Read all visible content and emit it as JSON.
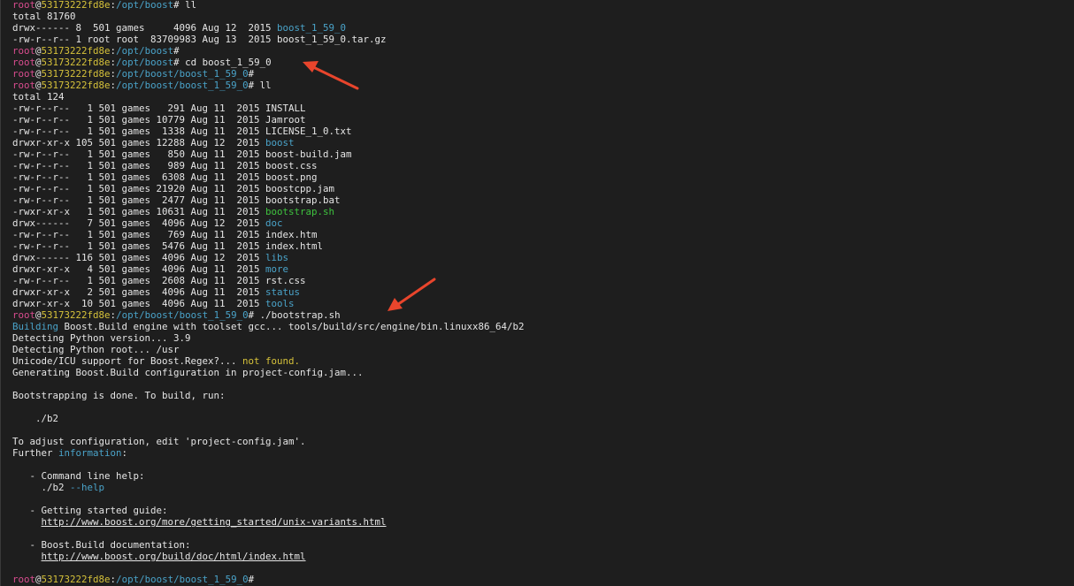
{
  "terminal": {
    "background": "#1e1e1e",
    "colors": {
      "user": "#d84c8e",
      "host": "#d6c23a",
      "path": "#4aa3c9",
      "directory": "#4aa3c9",
      "executable": "#3ec23e",
      "warning": "#d6c23a",
      "text": "#e6e6e6",
      "annotation_arrow": "#e8452c"
    },
    "lines": [
      [
        {
          "t": "root",
          "c": "user"
        },
        {
          "t": "@",
          "c": "default"
        },
        {
          "t": "53173222fd8e",
          "c": "host"
        },
        {
          "t": ":",
          "c": "default"
        },
        {
          "t": "/opt/boost",
          "c": "path"
        },
        {
          "t": "# ll",
          "c": "default"
        }
      ],
      [
        {
          "t": "total 81760",
          "c": "default"
        }
      ],
      [
        {
          "t": "drwx------ 8  501 games     4096 Aug 12  2015 ",
          "c": "default"
        },
        {
          "t": "boost_1_59_0",
          "c": "dir"
        }
      ],
      [
        {
          "t": "-rw-r--r-- 1 root root  83709983 Aug 13  2015 boost_1_59_0.tar.gz",
          "c": "default"
        }
      ],
      [
        {
          "t": "root",
          "c": "user"
        },
        {
          "t": "@",
          "c": "default"
        },
        {
          "t": "53173222fd8e",
          "c": "host"
        },
        {
          "t": ":",
          "c": "default"
        },
        {
          "t": "/opt/boost",
          "c": "path"
        },
        {
          "t": "#",
          "c": "default"
        }
      ],
      [
        {
          "t": "root",
          "c": "user"
        },
        {
          "t": "@",
          "c": "default"
        },
        {
          "t": "53173222fd8e",
          "c": "host"
        },
        {
          "t": ":",
          "c": "default"
        },
        {
          "t": "/opt/boost",
          "c": "path"
        },
        {
          "t": "# cd boost_1_59_0",
          "c": "default"
        }
      ],
      [
        {
          "t": "root",
          "c": "user"
        },
        {
          "t": "@",
          "c": "default"
        },
        {
          "t": "53173222fd8e",
          "c": "host"
        },
        {
          "t": ":",
          "c": "default"
        },
        {
          "t": "/opt/boost/boost_1_59_0",
          "c": "path"
        },
        {
          "t": "#",
          "c": "default"
        }
      ],
      [
        {
          "t": "root",
          "c": "user"
        },
        {
          "t": "@",
          "c": "default"
        },
        {
          "t": "53173222fd8e",
          "c": "host"
        },
        {
          "t": ":",
          "c": "default"
        },
        {
          "t": "/opt/boost/boost_1_59_0",
          "c": "path"
        },
        {
          "t": "# ll",
          "c": "default"
        }
      ],
      [
        {
          "t": "total 124",
          "c": "default"
        }
      ],
      [
        {
          "t": "-rw-r--r--   1 501 games   291 Aug 11  2015 INSTALL",
          "c": "default"
        }
      ],
      [
        {
          "t": "-rw-r--r--   1 501 games 10779 Aug 11  2015 Jamroot",
          "c": "default"
        }
      ],
      [
        {
          "t": "-rw-r--r--   1 501 games  1338 Aug 11  2015 LICENSE_1_0.txt",
          "c": "default"
        }
      ],
      [
        {
          "t": "drwxr-xr-x 105 501 games 12288 Aug 12  2015 ",
          "c": "default"
        },
        {
          "t": "boost",
          "c": "dir"
        }
      ],
      [
        {
          "t": "-rw-r--r--   1 501 games   850 Aug 11  2015 boost-build.jam",
          "c": "default"
        }
      ],
      [
        {
          "t": "-rw-r--r--   1 501 games   989 Aug 11  2015 boost.css",
          "c": "default"
        }
      ],
      [
        {
          "t": "-rw-r--r--   1 501 games  6308 Aug 11  2015 boost.png",
          "c": "default"
        }
      ],
      [
        {
          "t": "-rw-r--r--   1 501 games 21920 Aug 11  2015 boostcpp.jam",
          "c": "default"
        }
      ],
      [
        {
          "t": "-rw-r--r--   1 501 games  2477 Aug 11  2015 bootstrap.bat",
          "c": "default"
        }
      ],
      [
        {
          "t": "-rwxr-xr-x   1 501 games 10631 Aug 11  2015 ",
          "c": "default"
        },
        {
          "t": "bootstrap.sh",
          "c": "exec"
        }
      ],
      [
        {
          "t": "drwx------   7 501 games  4096 Aug 12  2015 ",
          "c": "default"
        },
        {
          "t": "doc",
          "c": "dir"
        }
      ],
      [
        {
          "t": "-rw-r--r--   1 501 games   769 Aug 11  2015 index.htm",
          "c": "default"
        }
      ],
      [
        {
          "t": "-rw-r--r--   1 501 games  5476 Aug 11  2015 index.html",
          "c": "default"
        }
      ],
      [
        {
          "t": "drwx------ 116 501 games  4096 Aug 12  2015 ",
          "c": "default"
        },
        {
          "t": "libs",
          "c": "dir"
        }
      ],
      [
        {
          "t": "drwxr-xr-x   4 501 games  4096 Aug 11  2015 ",
          "c": "default"
        },
        {
          "t": "more",
          "c": "dir"
        }
      ],
      [
        {
          "t": "-rw-r--r--   1 501 games  2608 Aug 11  2015 rst.css",
          "c": "default"
        }
      ],
      [
        {
          "t": "drwxr-xr-x   2 501 games  4096 Aug 11  2015 ",
          "c": "default"
        },
        {
          "t": "status",
          "c": "dir"
        }
      ],
      [
        {
          "t": "drwxr-xr-x  10 501 games  4096 Aug 11  2015 ",
          "c": "default"
        },
        {
          "t": "tools",
          "c": "dir"
        }
      ],
      [
        {
          "t": "root",
          "c": "user"
        },
        {
          "t": "@",
          "c": "default"
        },
        {
          "t": "53173222fd8e",
          "c": "host"
        },
        {
          "t": ":",
          "c": "default"
        },
        {
          "t": "/opt/boost/boost_1_59_0",
          "c": "path"
        },
        {
          "t": "# ./bootstrap.sh",
          "c": "default"
        }
      ],
      [
        {
          "t": "Building",
          "c": "path"
        },
        {
          "t": " Boost.Build engine with toolset gcc... tools/build/src/engine/bin.linuxx86_64/b2",
          "c": "default"
        }
      ],
      [
        {
          "t": "Detecting Python version... 3.9",
          "c": "default"
        }
      ],
      [
        {
          "t": "Detecting Python root... /usr",
          "c": "default"
        }
      ],
      [
        {
          "t": "Unicode/ICU support for Boost.Regex?... ",
          "c": "default"
        },
        {
          "t": "not found.",
          "c": "warn"
        }
      ],
      [
        {
          "t": "Generating Boost.Build configuration in project-config.jam...",
          "c": "default"
        }
      ],
      [
        {
          "t": "",
          "c": "default"
        }
      ],
      [
        {
          "t": "Bootstrapping is done. To build, run:",
          "c": "default"
        }
      ],
      [
        {
          "t": "",
          "c": "default"
        }
      ],
      [
        {
          "t": "    ./b2",
          "c": "default"
        }
      ],
      [
        {
          "t": "",
          "c": "default"
        }
      ],
      [
        {
          "t": "To adjust configuration, edit 'project-config.jam'.",
          "c": "default"
        }
      ],
      [
        {
          "t": "Further ",
          "c": "default"
        },
        {
          "t": "information",
          "c": "path"
        },
        {
          "t": ":",
          "c": "default"
        }
      ],
      [
        {
          "t": "",
          "c": "default"
        }
      ],
      [
        {
          "t": "   - Command line help:",
          "c": "default"
        }
      ],
      [
        {
          "t": "     ./b2 ",
          "c": "default"
        },
        {
          "t": "--help",
          "c": "path"
        }
      ],
      [
        {
          "t": "",
          "c": "default"
        }
      ],
      [
        {
          "t": "   - Getting started guide:",
          "c": "default"
        }
      ],
      [
        {
          "t": "     ",
          "c": "default"
        },
        {
          "t": "http://www.boost.org/more/getting_started/unix-variants.html",
          "c": "link"
        }
      ],
      [
        {
          "t": "",
          "c": "default"
        }
      ],
      [
        {
          "t": "   - Boost.Build documentation:",
          "c": "default"
        }
      ],
      [
        {
          "t": "     ",
          "c": "default"
        },
        {
          "t": "http://www.boost.org/build/doc/html/index.html",
          "c": "link"
        }
      ],
      [
        {
          "t": "",
          "c": "default"
        }
      ],
      [
        {
          "t": "root",
          "c": "user"
        },
        {
          "t": "@",
          "c": "default"
        },
        {
          "t": "53173222fd8e",
          "c": "host"
        },
        {
          "t": ":",
          "c": "default"
        },
        {
          "t": "/opt/boost/boost_1_59_0",
          "c": "path"
        },
        {
          "t": "#",
          "c": "default"
        }
      ]
    ]
  },
  "annotations": [
    {
      "icon": "red-arrow-icon",
      "points_to": "cd boost_1_59_0"
    },
    {
      "icon": "red-arrow-icon",
      "points_to": "./bootstrap.sh"
    }
  ]
}
